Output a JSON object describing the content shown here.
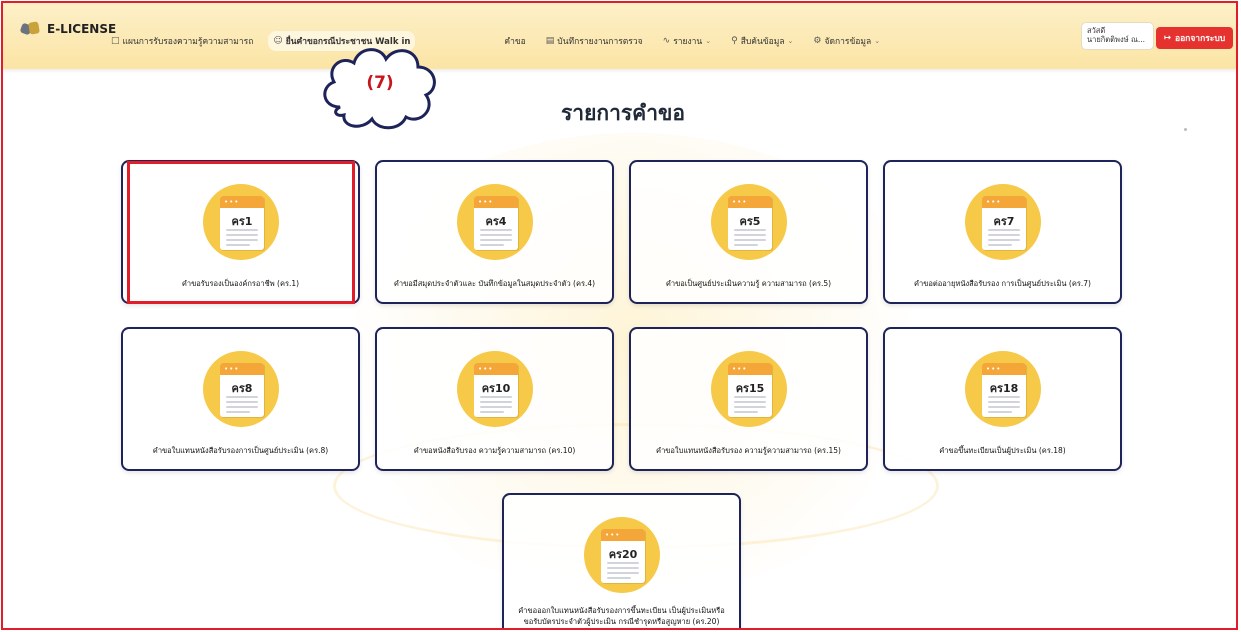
{
  "brand": "E-LICENSE",
  "nav": {
    "items": [
      {
        "label": "แผนการรับรองความรู้ความสามารถ",
        "icon": "book-icon",
        "caret": false,
        "active": false
      },
      {
        "label": "ยื่นคำขอกรณีประชาชน Walk in",
        "icon": "user-icon",
        "caret": false,
        "active": true
      },
      {
        "label": "คำขอ",
        "icon": "document-icon",
        "caret": false,
        "active": false
      },
      {
        "label": "บันทึกรายงานการตรวจ",
        "icon": "clipboard-icon",
        "caret": false,
        "active": false
      },
      {
        "label": "รายงาน",
        "icon": "activity-icon",
        "caret": true,
        "active": false
      },
      {
        "label": "สืบค้นข้อมูล",
        "icon": "search-icon",
        "caret": true,
        "active": false
      },
      {
        "label": "จัดการข้อมูล",
        "icon": "gear-icon",
        "caret": true,
        "active": false
      }
    ],
    "user_greeting": "สวัสดี",
    "user_name": "นายกิตติพงษ์ ณ...",
    "logout_label": "ออกจากระบบ"
  },
  "annotation": "(7)",
  "page_title": "รายการคำขอ",
  "cards": [
    {
      "code": "คร1",
      "title": "คำขอรับรองเป็นองค์กรอาชีพ (คร.1)"
    },
    {
      "code": "คร4",
      "title": "คำขอมีสมุดประจำตัวและ บันทึกข้อมูลในสมุดประจำตัว (คร.4)"
    },
    {
      "code": "คร5",
      "title": "คำขอเป็นศูนย์ประเมินความรู้ ความสามารถ (คร.5)"
    },
    {
      "code": "คร7",
      "title": "คำขอต่ออายุหนังสือรับรอง การเป็นศูนย์ประเมิน (คร.7)"
    },
    {
      "code": "คร8",
      "title": "คำขอใบแทนหนังสือรับรองการเป็นศูนย์ประเมิน (คร.8)"
    },
    {
      "code": "คร10",
      "title": "คำขอหนังสือรับรอง ความรู้ความสามารถ (คร.10)"
    },
    {
      "code": "คร15",
      "title": "คำขอใบแทนหนังสือรับรอง ความรู้ความสามารถ (คร.15)"
    },
    {
      "code": "คร18",
      "title": "คำขอขึ้นทะเบียนเป็นผู้ประเมิน (คร.18)"
    },
    {
      "code": "คร20",
      "title": "คำขอออกใบแทนหนังสือรับรองการขึ้นทะเบียน เป็นผู้ประเมินหรือ ขอรับบัตรประจำตัวผู้ประเมิน กรณีชำรุดหรือสูญหาย (คร.20)"
    }
  ],
  "colors": {
    "navbar": "#fbe4a4",
    "card_border": "#1e2359",
    "icon_circle": "#f7c948",
    "highlight": "#e11d2a",
    "logout": "#e5322e"
  }
}
